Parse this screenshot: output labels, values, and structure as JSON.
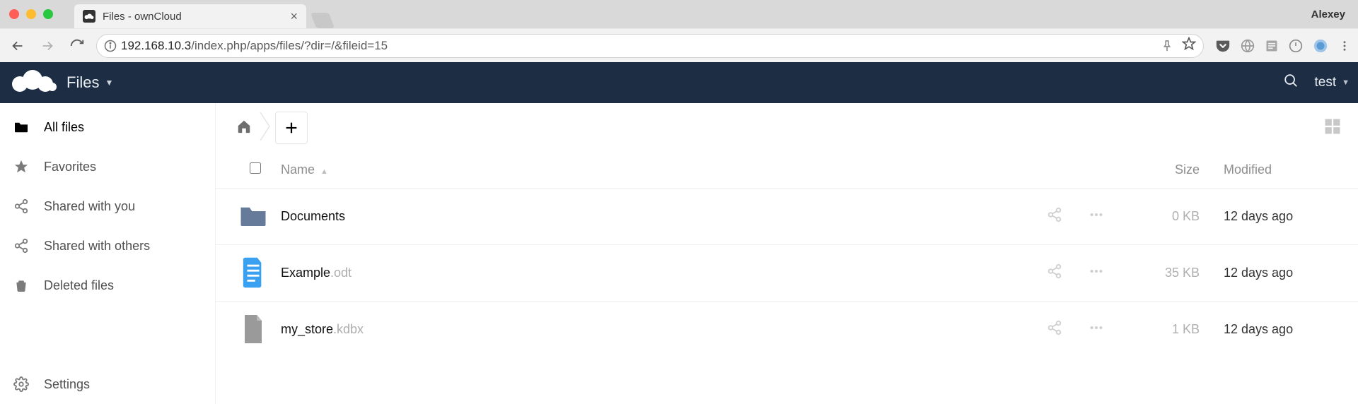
{
  "browser": {
    "os_user": "Alexey",
    "tab_title": "Files - ownCloud",
    "url_host": "192.168.10.3",
    "url_path": "/index.php/apps/files/?dir=/&fileid=15"
  },
  "header": {
    "nav_label": "Files",
    "user_label": "test"
  },
  "sidebar": {
    "items": [
      {
        "label": "All files"
      },
      {
        "label": "Favorites"
      },
      {
        "label": "Shared with you"
      },
      {
        "label": "Shared with others"
      },
      {
        "label": "Deleted files"
      }
    ],
    "settings_label": "Settings"
  },
  "list": {
    "columns": {
      "name": "Name",
      "size": "Size",
      "modified": "Modified"
    },
    "rows": [
      {
        "type": "folder",
        "name": "Documents",
        "ext": "",
        "size": "0 KB",
        "modified": "12 days ago"
      },
      {
        "type": "doc",
        "name": "Example",
        "ext": ".odt",
        "size": "35 KB",
        "modified": "12 days ago"
      },
      {
        "type": "file",
        "name": "my_store",
        "ext": ".kdbx",
        "size": "1 KB",
        "modified": "12 days ago"
      }
    ]
  }
}
